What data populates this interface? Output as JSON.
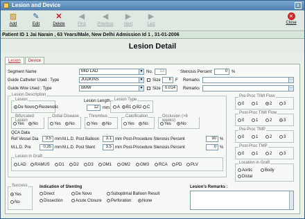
{
  "window": {
    "title": "Lesion and Device",
    "close_glyph": "x"
  },
  "toolbar": {
    "add": "Add",
    "edit": "Edit",
    "delete": "Delete",
    "first": "First",
    "previous": "Previous",
    "next": "Next",
    "last": "Last",
    "close": "Close"
  },
  "patient_info": "Patient ID 1 Jai Narain , 63 Years/Male, New Delhi Admission Id 1 , 31-01-2006",
  "heading": "Lesion Detail",
  "tabs": [
    "Lesion",
    "Device"
  ],
  "segment": {
    "label": "Segment Name",
    "value": "MID LAD",
    "no_label": "No.",
    "no_value": "13",
    "stenosis_label": "Stenosis Percent",
    "stenosis_value": "0",
    "pct": "%"
  },
  "catheter": {
    "label": "Guide Catheter Used : Type",
    "value": "JUDKINS",
    "size_label": "Size",
    "size_value": "6",
    "unit": "F",
    "remarks_label": "Remarks"
  },
  "wire": {
    "label": "Guide Wire Used : Type",
    "value": "BMW",
    "size_label": "Size",
    "size_value": "0.014",
    "remarks_label": "Remarks"
  },
  "lesion_desc": {
    "title": "Lesion Description",
    "lesion_label": "Lesion",
    "lesion_options": [
      "De Novo",
      "Restenotic"
    ],
    "length_label": "Lesion Length",
    "length_value": "12",
    "length_unit": "mm",
    "type_label": "Lesion Type",
    "type_options": [
      "A",
      "B1",
      "B2",
      "C"
    ],
    "bifurcated_label": "Bifurcated Lesion",
    "ostial_label": "Ostial Disease",
    "thrombus_label": "Thrombus",
    "calcification_label": "Calcification",
    "occlusion_label": "Occlusion (>6 weeks)",
    "yes": "Yes",
    "no": "No"
  },
  "qca": {
    "title": "QCA Data",
    "ref_label": "Ref Vessel Dia",
    "ref_value": "3.5",
    "mld_post_balloon_label": "M.L.D. Post Balloon",
    "mld_post_balloon_value": "3.1",
    "post_proc_stenosis_label": "Post-Procedure Stenosis Percent",
    "post_proc_stenosis_value": "90",
    "mld_pre_label": "M.L.D. Pre",
    "mld_pre_value": "0.35",
    "mld_post_stent_label": "M.L.D. Post Stent",
    "mld_post_stent_value": "3.5",
    "post_proc_stenosis2_label": "Post-Procedure Stenosis Percent",
    "post_proc_stenosis2_value": "0",
    "mm": "mm",
    "pct": "%"
  },
  "graft": {
    "title": "Lesion in Graft",
    "options": [
      "LAD",
      "RAMUS",
      "D1",
      "D2",
      "D3",
      "OM1",
      "OM2",
      "OM3",
      "RCA",
      "PD",
      "PLV"
    ]
  },
  "timi_pre": {
    "title": "Pre-Proc TIMI Flow",
    "options": [
      "0",
      "1",
      "2",
      "3"
    ]
  },
  "timi_post": {
    "title": "Post-Proc TIMI Flow",
    "options": [
      "0",
      "1",
      "2",
      "3"
    ]
  },
  "tmp_pre": {
    "title": "Pre-Proc TMP",
    "options": [
      "0",
      "1",
      "2",
      "3"
    ]
  },
  "tmp_post": {
    "title": "Post-Proc TMP",
    "options": [
      "0",
      "1",
      "2",
      "3"
    ]
  },
  "graft_location": {
    "title": "Location in Graft",
    "options": [
      "Aortic",
      "Body",
      "Distal"
    ]
  },
  "success": {
    "title": "Success",
    "options": [
      "Yes",
      "No"
    ]
  },
  "stenting": {
    "title": "Indication of Stenting",
    "options": [
      "Direct",
      "De Novo",
      "Suboptimal Balloon Result",
      "Dissection",
      "Acute Closure",
      "Perforation",
      "None"
    ]
  },
  "lesion_remarks": {
    "label": "Lesion's Remarks :"
  }
}
